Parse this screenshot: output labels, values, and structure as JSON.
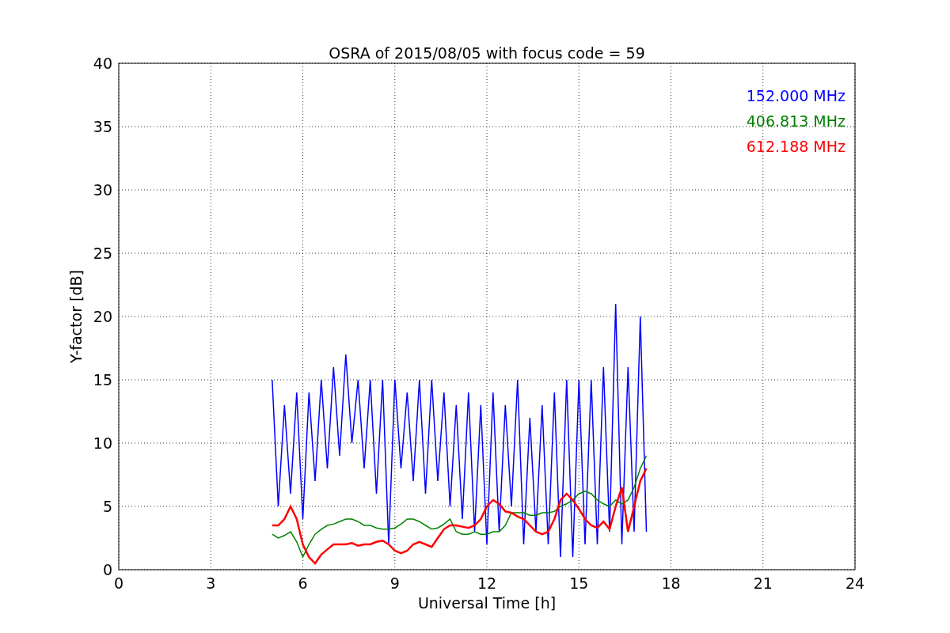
{
  "chart_data": {
    "type": "line",
    "grid": true,
    "title": "OSRA of 2015/08/05 with focus code = 59",
    "xlabel": "Universal Time [h]",
    "ylabel": "Y-factor [dB]",
    "xlim": [
      0,
      24
    ],
    "ylim": [
      0,
      40
    ],
    "xticks": [
      0,
      3,
      6,
      9,
      12,
      15,
      18,
      21,
      24
    ],
    "yticks": [
      0,
      5,
      10,
      15,
      20,
      25,
      30,
      35,
      40
    ],
    "x": [
      5.0,
      5.2,
      5.4,
      5.6,
      5.8,
      6.0,
      6.2,
      6.4,
      6.6,
      6.8,
      7.0,
      7.2,
      7.4,
      7.6,
      7.8,
      8.0,
      8.2,
      8.4,
      8.6,
      8.8,
      9.0,
      9.2,
      9.4,
      9.6,
      9.8,
      10.0,
      10.2,
      10.4,
      10.6,
      10.8,
      11.0,
      11.2,
      11.4,
      11.6,
      11.8,
      12.0,
      12.2,
      12.4,
      12.6,
      12.8,
      13.0,
      13.2,
      13.4,
      13.6,
      13.8,
      14.0,
      14.2,
      14.4,
      14.6,
      14.8,
      15.0,
      15.2,
      15.4,
      15.6,
      15.8,
      16.0,
      16.2,
      16.4,
      16.6,
      16.8,
      17.0,
      17.2
    ],
    "series": [
      {
        "name": "152.000 MHz",
        "color": "#0000ff",
        "values": [
          15,
          5,
          13,
          6,
          14,
          4,
          14,
          7,
          15,
          8,
          16,
          9,
          17,
          10,
          15,
          8,
          15,
          6,
          15,
          2,
          15,
          8,
          14,
          7,
          15,
          6,
          15,
          7,
          14,
          5,
          13,
          4,
          14,
          3,
          13,
          2,
          14,
          3,
          13,
          5,
          15,
          2,
          12,
          3,
          13,
          2,
          14,
          1,
          15,
          1,
          15,
          2,
          15,
          2,
          16,
          3,
          21,
          2,
          16,
          3,
          20,
          3
        ]
      },
      {
        "name": "406.813 MHz",
        "color": "#008000",
        "values": [
          2.8,
          2.5,
          2.7,
          3,
          2.2,
          1,
          2,
          2.8,
          3.2,
          3.5,
          3.6,
          3.8,
          4,
          4,
          3.8,
          3.5,
          3.5,
          3.3,
          3.2,
          3.2,
          3.3,
          3.6,
          4,
          4,
          3.8,
          3.5,
          3.2,
          3.3,
          3.6,
          4,
          3,
          2.8,
          2.8,
          3,
          2.8,
          2.8,
          3,
          3,
          3.5,
          4.5,
          4.5,
          4.5,
          4.3,
          4.3,
          4.5,
          4.5,
          4.6,
          5,
          5.2,
          5.5,
          6,
          6.2,
          6,
          5.5,
          5.2,
          5,
          5.5,
          5.2,
          5.5,
          6.5,
          8,
          9
        ]
      },
      {
        "name": "612.188 MHz",
        "color": "#ff0000",
        "values": [
          3.5,
          3.5,
          4,
          5,
          4,
          2,
          1,
          0.5,
          1.2,
          1.6,
          2,
          2,
          2,
          2.1,
          1.9,
          2,
          2,
          2.2,
          2.3,
          2,
          1.5,
          1.3,
          1.5,
          2,
          2.2,
          2,
          1.8,
          2.5,
          3.2,
          3.5,
          3.5,
          3.4,
          3.3,
          3.5,
          4,
          5,
          5.5,
          5.2,
          4.6,
          4.5,
          4.2,
          4,
          3.5,
          3,
          2.8,
          3,
          4,
          5.5,
          6,
          5.5,
          4.8,
          4,
          3.5,
          3.3,
          3.8,
          3.2,
          5,
          6.5,
          3,
          5,
          7,
          8
        ]
      }
    ]
  }
}
